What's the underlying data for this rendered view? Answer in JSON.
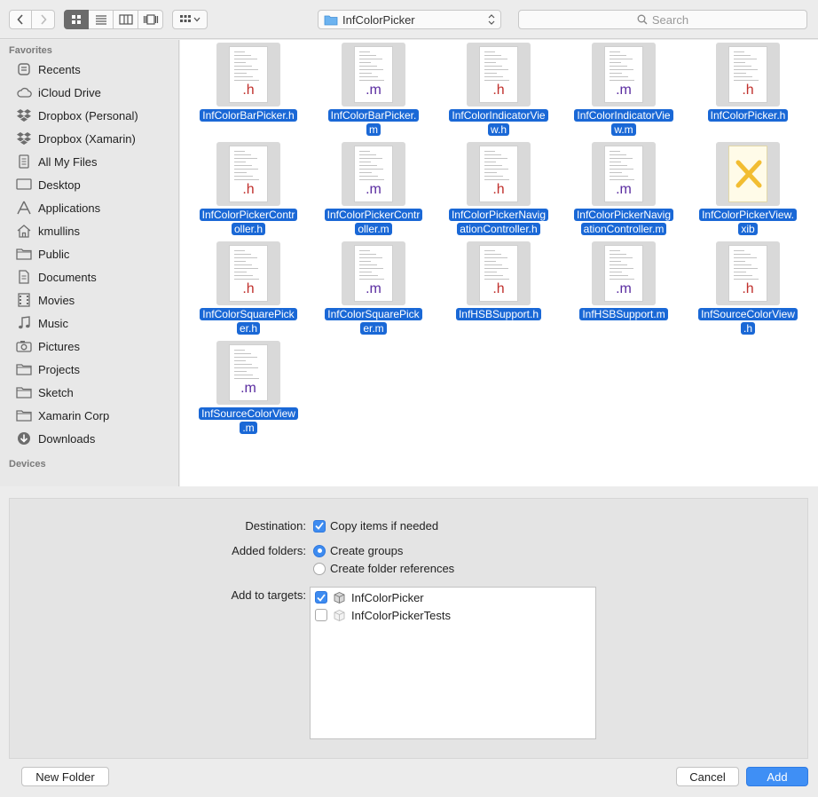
{
  "toolbar": {
    "path_label": "InfColorPicker",
    "search_placeholder": "Search"
  },
  "sidebar": {
    "favorites_header": "Favorites",
    "devices_header": "Devices",
    "items": [
      {
        "label": "Recents",
        "icon": "recents-icon"
      },
      {
        "label": "iCloud Drive",
        "icon": "cloud-icon"
      },
      {
        "label": "Dropbox (Personal)",
        "icon": "dropbox-icon"
      },
      {
        "label": "Dropbox (Xamarin)",
        "icon": "dropbox-icon"
      },
      {
        "label": "All My Files",
        "icon": "all-files-icon"
      },
      {
        "label": "Desktop",
        "icon": "desktop-icon"
      },
      {
        "label": "Applications",
        "icon": "applications-icon"
      },
      {
        "label": "kmullins",
        "icon": "home-icon"
      },
      {
        "label": "Public",
        "icon": "folder-icon"
      },
      {
        "label": "Documents",
        "icon": "documents-icon"
      },
      {
        "label": "Movies",
        "icon": "movies-icon"
      },
      {
        "label": "Music",
        "icon": "music-icon"
      },
      {
        "label": "Pictures",
        "icon": "pictures-icon"
      },
      {
        "label": "Projects",
        "icon": "folder-icon"
      },
      {
        "label": "Sketch",
        "icon": "folder-icon"
      },
      {
        "label": "Xamarin Corp",
        "icon": "folder-icon"
      },
      {
        "label": "Downloads",
        "icon": "downloads-icon"
      }
    ]
  },
  "files": [
    {
      "line1": "InfColorBarPicker.h",
      "line2": "",
      "ext": ".h"
    },
    {
      "line1": "InfColorBarPicker.",
      "line2": "m",
      "ext": ".m"
    },
    {
      "line1": "InfColorIndicatorVie",
      "line2": "w.h",
      "ext": ".h"
    },
    {
      "line1": "InfColorIndicatorVie",
      "line2": "w.m",
      "ext": ".m"
    },
    {
      "line1": "InfColorPicker.h",
      "line2": "",
      "ext": ".h"
    },
    {
      "line1": "InfColorPickerContr",
      "line2": "oller.h",
      "ext": ".h"
    },
    {
      "line1": "InfColorPickerContr",
      "line2": "oller.m",
      "ext": ".m"
    },
    {
      "line1": "InfColorPickerNavig",
      "line2": "ationController.h",
      "ext": ".h"
    },
    {
      "line1": "InfColorPickerNavig",
      "line2": "ationController.m",
      "ext": ".m"
    },
    {
      "line1": "InfColorPickerView.",
      "line2": "xib",
      "ext": "xib"
    },
    {
      "line1": "InfColorSquarePick",
      "line2": "er.h",
      "ext": ".h"
    },
    {
      "line1": "InfColorSquarePick",
      "line2": "er.m",
      "ext": ".m"
    },
    {
      "line1": "InfHSBSupport.h",
      "line2": "",
      "ext": ".h"
    },
    {
      "line1": "InfHSBSupport.m",
      "line2": "",
      "ext": ".m"
    },
    {
      "line1": "InfSourceColorView",
      "line2": ".h",
      "ext": ".h"
    },
    {
      "line1": "InfSourceColorView",
      "line2": ".m",
      "ext": ".m"
    }
  ],
  "options": {
    "destination_label": "Destination:",
    "copy_items_label": "Copy items if needed",
    "copy_items_checked": true,
    "added_folders_label": "Added folders:",
    "create_groups_label": "Create groups",
    "create_refs_label": "Create folder references",
    "selected_folder_option": "Create groups",
    "targets_label": "Add to targets:",
    "targets": [
      {
        "name": "InfColorPicker",
        "checked": true
      },
      {
        "name": "InfColorPickerTests",
        "checked": false
      }
    ]
  },
  "buttons": {
    "new_folder": "New Folder",
    "cancel": "Cancel",
    "add": "Add"
  },
  "colors": {
    "accent": "#3f8ff5",
    "selection": "#1a68d6",
    "h_ext": "#c0302c",
    "m_ext": "#5a2ca0"
  }
}
